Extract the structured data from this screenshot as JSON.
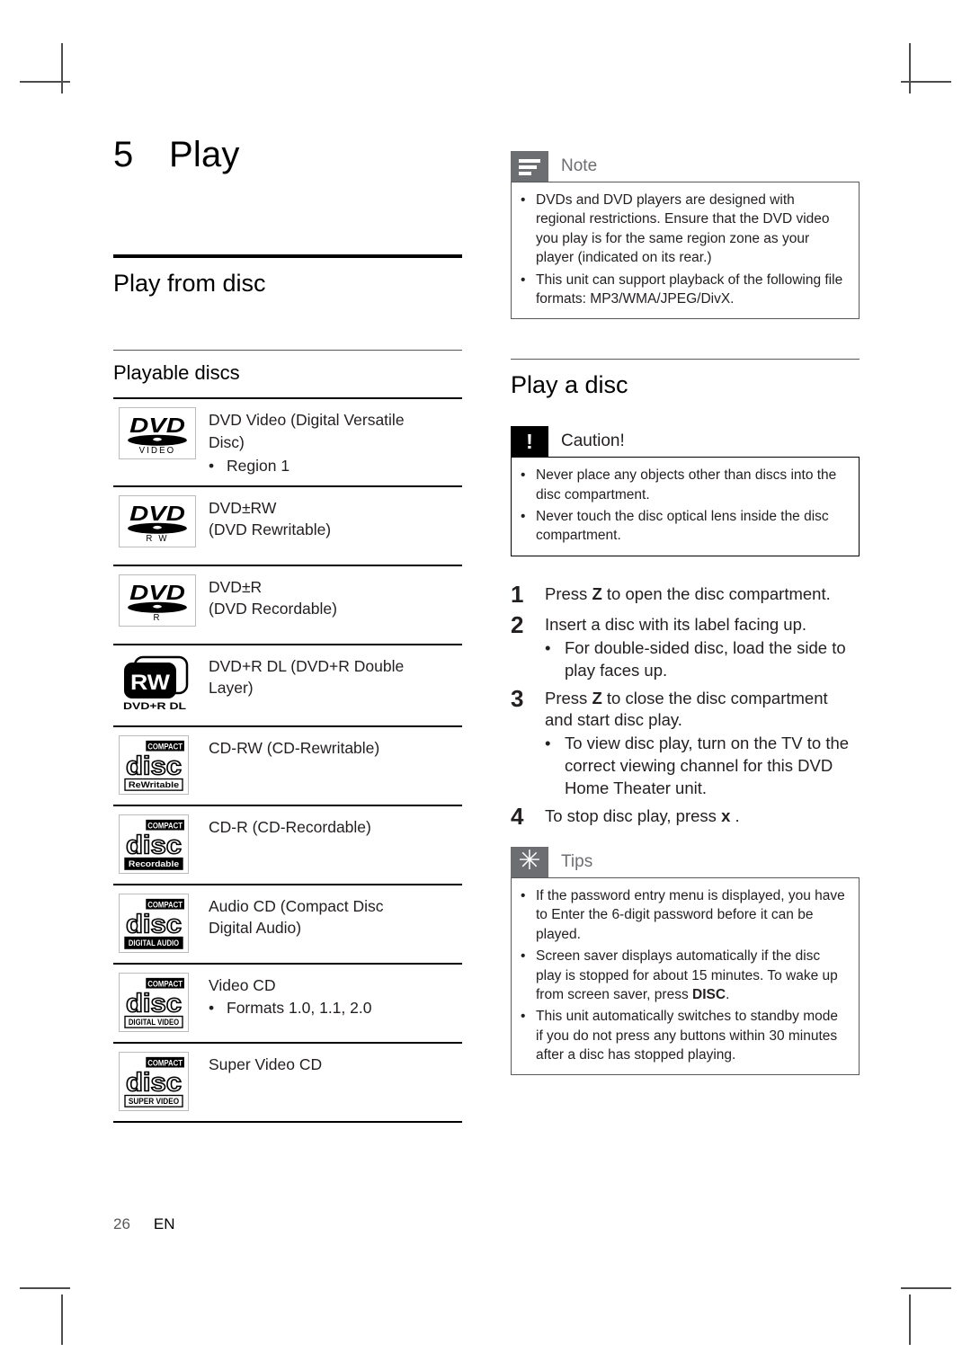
{
  "chapter": {
    "number": "5",
    "title": "Play"
  },
  "left_column": {
    "section_heading": "Play from disc",
    "sub_heading": "Playable discs",
    "disc_rows": [
      {
        "logo": "dvd-video-logo",
        "logo_caption": "VIDEO",
        "lines": [
          "DVD Video (Digital Versatile",
          "Disc)"
        ],
        "bullets": [
          "Region 1"
        ]
      },
      {
        "logo": "dvd-rw-logo",
        "logo_caption": "R W",
        "lines": [
          "DVD±RW",
          "(DVD Rewritable)"
        ],
        "bullets": []
      },
      {
        "logo": "dvd-r-logo",
        "logo_caption": "R",
        "lines": [
          "DVD±R",
          "(DVD Recordable)"
        ],
        "bullets": []
      },
      {
        "logo": "dvd-plus-r-dl-logo",
        "logo_caption": "DVD+R DL",
        "lines": [
          "DVD+R DL (DVD+R Double",
          "Layer)"
        ],
        "bullets": []
      },
      {
        "logo": "cd-rewritable-logo",
        "logo_caption": "ReWritable",
        "lines": [
          "CD-RW (CD-Rewritable)"
        ],
        "bullets": []
      },
      {
        "logo": "cd-recordable-logo",
        "logo_caption": "Recordable",
        "lines": [
          "CD-R (CD-Recordable)"
        ],
        "bullets": []
      },
      {
        "logo": "cd-digital-audio-logo",
        "logo_caption": "DIGITAL AUDIO",
        "lines": [
          "Audio CD (Compact Disc",
          "Digital Audio)"
        ],
        "bullets": []
      },
      {
        "logo": "cd-digital-video-logo",
        "logo_caption": "DIGITAL VIDEO",
        "lines": [
          "Video CD"
        ],
        "bullets": [
          "Formats 1.0, 1.1, 2.0"
        ]
      },
      {
        "logo": "cd-super-video-logo",
        "logo_caption": "SUPER VIDEO",
        "lines": [
          "Super Video CD"
        ],
        "bullets": []
      }
    ],
    "logo_text": {
      "dvd": "DVD",
      "compact": "COMPACT",
      "disc": "disc",
      "rw": "RW"
    }
  },
  "right_column": {
    "note_box": {
      "label": "Note",
      "icon": "note-lines-icon",
      "bullets": [
        "DVDs and DVD players are designed with regional restrictions.  Ensure that the DVD video you play is for the same region zone as your player (indicated on its rear.)",
        "This unit can support playback of the following file formats: MP3/WMA/JPEG/DivX."
      ]
    },
    "section_heading": "Play a disc",
    "caution_box": {
      "label": "Caution!",
      "icon": "exclamation-icon",
      "glyph": "!",
      "bullets": [
        "Never place any objects other than discs into the disc compartment.",
        "Never touch the disc optical lens inside the disc compartment."
      ]
    },
    "steps": [
      {
        "number": "1",
        "text_before": "Press ",
        "key": "Z",
        "text_after": " to open the disc compartment.",
        "subs": []
      },
      {
        "number": "2",
        "text_before": "Insert a disc with its label facing up.",
        "key": "",
        "text_after": "",
        "subs": [
          "For double-sided disc, load the side to play faces up."
        ]
      },
      {
        "number": "3",
        "text_before": "Press ",
        "key": "Z",
        "text_after": " to close the disc compartment and start disc play.",
        "subs": [
          "To view disc play, turn on the TV to the correct viewing channel for this DVD Home Theater unit."
        ]
      },
      {
        "number": "4",
        "text_before": "To stop disc play, press ",
        "key": "x",
        "text_after": " .",
        "subs": []
      }
    ],
    "tips_box": {
      "label": "Tips",
      "icon": "asterisk-icon",
      "glyph": "✳",
      "bullets": [
        {
          "text_a": "If the password entry menu is displayed, you have to Enter the 6-digit password before it can be played.",
          "bold": "",
          "text_b": ""
        },
        {
          "text_a": "Screen saver displays automatically if the disc play is stopped for about 15 minutes. To wake up from screen saver, press ",
          "bold": "DISC",
          "text_b": "."
        },
        {
          "text_a": "This unit automatically switches to standby mode if you do not press any buttons within 30 minutes after a disc has stopped playing.",
          "bold": "",
          "text_b": ""
        }
      ]
    }
  },
  "footer": {
    "page_number": "26",
    "language": "EN"
  },
  "bullet_glyph": "•"
}
